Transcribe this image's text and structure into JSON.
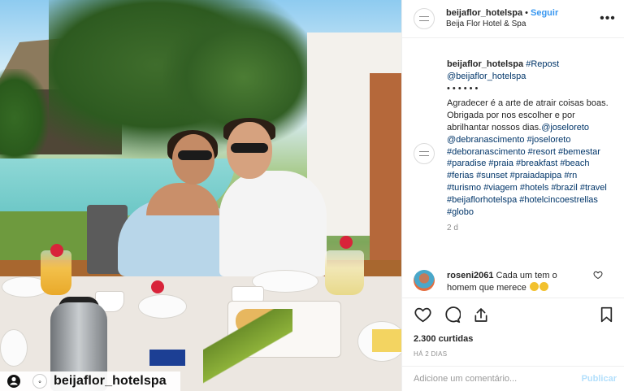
{
  "photo": {
    "watermark_text": "beijaflor_hotelspa",
    "watermark_icon": "instagram-glyph-icon"
  },
  "header": {
    "username": "beijaflor_hotelspa",
    "separator": "•",
    "follow_label": "Seguir",
    "location": "Beija Flor Hotel & Spa",
    "more_label": "•••"
  },
  "caption": {
    "username": "beijaflor_hotelspa",
    "repost_tag": "#Repost",
    "repost_handle": "@beijaflor_hotelspa",
    "dots": "• • • • • •",
    "text_1": "Agradecer é a arte de atrair coisas boas. Obrigada por nos escolher e por abrilhantar nossos dias.",
    "mention_1": "@joseloreto",
    "mention_2": "@debranascimento",
    "hashtags": "#joseloreto #deboranascimento #resort #bemestar #paradise #praia #breakfast #beach #ferias #sunset #praiadapipa #rn #turismo #viagem #hotels #brazil #travel #beijaflorhotelspa #hotelcincoestrellas #globo",
    "time": "2 d"
  },
  "reply": {
    "username": "roseni2061",
    "text": "Cada um tem o homem que merece"
  },
  "actions": {
    "likes": "2.300 curtidas",
    "date": "HÁ 2 DIAS"
  },
  "comment_box": {
    "placeholder": "Adicione um comentário...",
    "publish_label": "Publicar"
  },
  "colors": {
    "link": "#003569",
    "follow": "#3897f0",
    "publish_disabled": "#b2dffc",
    "muted": "#8e8e8e"
  }
}
